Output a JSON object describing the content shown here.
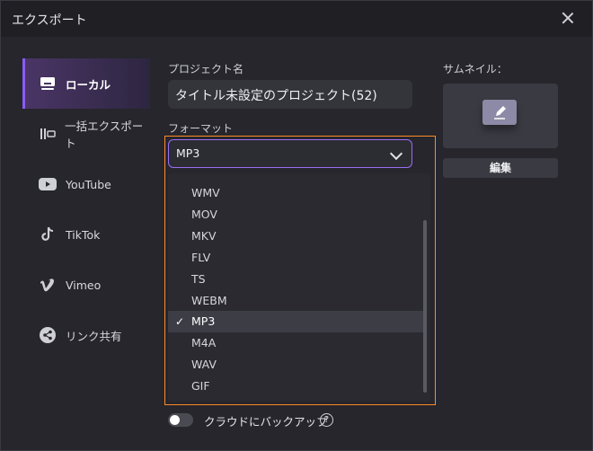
{
  "window": {
    "title": "エクスポート"
  },
  "sidebar": {
    "items": [
      {
        "label": "ローカル",
        "icon": "monitor-icon",
        "active": true
      },
      {
        "label": "一括エクスポート",
        "icon": "batch-export-icon"
      },
      {
        "label": "YouTube",
        "icon": "youtube-icon"
      },
      {
        "label": "TikTok",
        "icon": "tiktok-icon"
      },
      {
        "label": "Vimeo",
        "icon": "vimeo-icon"
      },
      {
        "label": "リンク共有",
        "icon": "share-icon"
      }
    ]
  },
  "main": {
    "project_label": "プロジェクト名",
    "project_name": "タイトル未設定のプロジェクト(52)",
    "format_label": "フォーマット",
    "format_selected": "MP3",
    "format_options": [
      "WMV",
      "MOV",
      "MKV",
      "FLV",
      "TS",
      "WEBM",
      "MP3",
      "M4A",
      "WAV",
      "GIF"
    ]
  },
  "thumbnail": {
    "label": "サムネイル：",
    "edit_label": "編集"
  },
  "cloud_backup": {
    "label": "クラウドにバックアップ",
    "help": "?"
  }
}
